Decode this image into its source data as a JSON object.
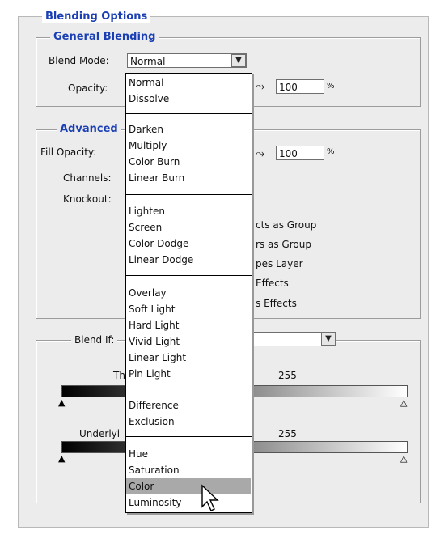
{
  "blending_options": {
    "title": "Blending Options",
    "general": {
      "title": "General Blending",
      "blend_mode_label": "Blend Mode:",
      "blend_mode_value": "Normal",
      "opacity_label": "Opacity:",
      "opacity_value": "100",
      "opacity_unit": "%"
    },
    "advanced": {
      "title": "Advanced",
      "fill_opacity_label": "Fill Opacity:",
      "fill_opacity_value": "100",
      "fill_unit": "%",
      "channels_label": "Channels:",
      "knockout_label": "Knockout:",
      "options": [
        "cts as Group",
        "rs as Group",
        "pes Layer",
        "Effects",
        "s Effects"
      ]
    },
    "blend_if": {
      "label": "Blend If:",
      "this_layer_label": "Th",
      "this_layer_value": "255",
      "underlying_label": "Underlyi",
      "underlying_value": "255"
    }
  },
  "menu": {
    "groups": [
      [
        "Normal",
        "Dissolve"
      ],
      [
        "Darken",
        "Multiply",
        "Color Burn",
        "Linear Burn"
      ],
      [
        "Lighten",
        "Screen",
        "Color Dodge",
        "Linear Dodge"
      ],
      [
        "Overlay",
        "Soft Light",
        "Hard Light",
        "Vivid Light",
        "Linear Light",
        "Pin Light"
      ],
      [
        "Difference",
        "Exclusion"
      ],
      [
        "Hue",
        "Saturation",
        "Color",
        "Luminosity"
      ]
    ],
    "selected": "Color"
  },
  "icons": {
    "dropdown": "chevron-down-icon",
    "scrubby": "scrubby-hand-icon",
    "slider": "triangle-slider-icon",
    "cursor": "mouse-pointer-icon"
  }
}
